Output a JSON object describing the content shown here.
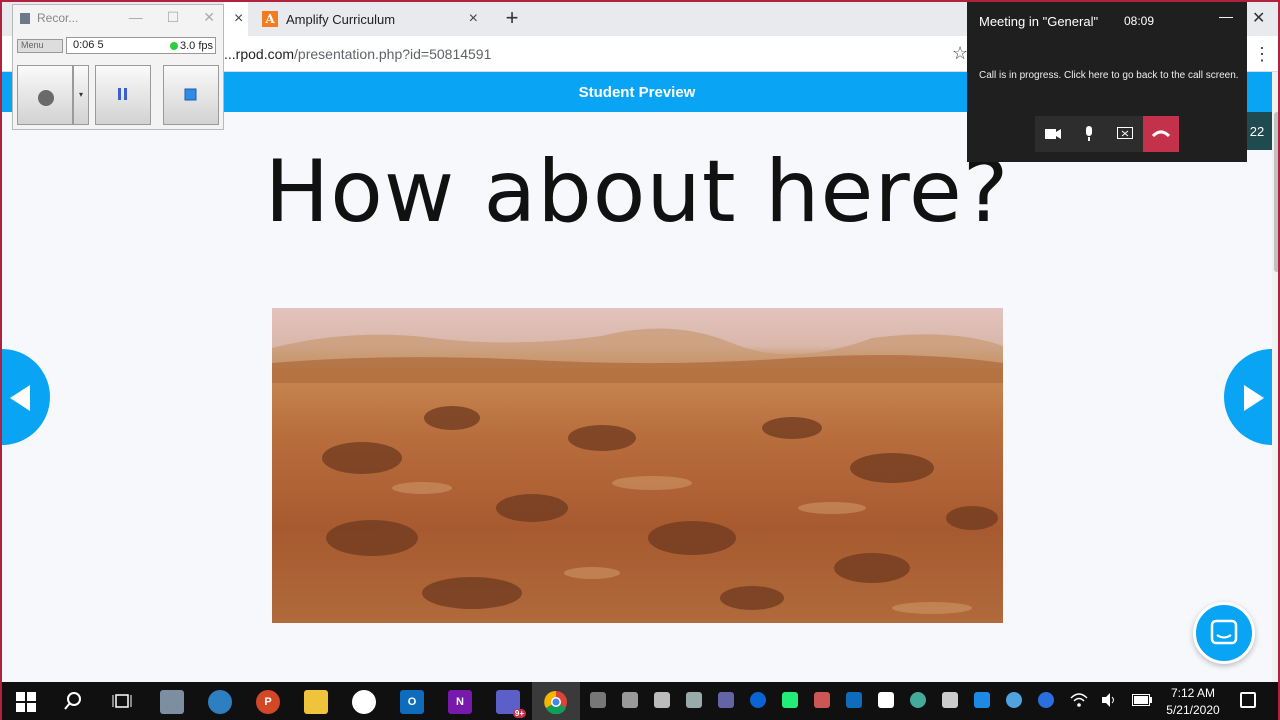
{
  "browser": {
    "tabs": [
      {
        "label": "Amplify Curriculum",
        "close": "×"
      }
    ],
    "first_tab_close": "×",
    "new_tab": "+",
    "url_prefix": "...rpod.com",
    "url_path": "/presentation.php?id=50814591",
    "star": "☆",
    "menu": "⋮"
  },
  "page": {
    "banner": "Student Preview",
    "slide_title": "How about here?",
    "counter": "22"
  },
  "recorder": {
    "title": "Recor...",
    "menu": "Menu",
    "time": "0:06 5",
    "fps": "3.0 fps",
    "min": "—",
    "max": "☐",
    "close": "✕",
    "drop": "▾"
  },
  "teams": {
    "title": "Meeting in \"General\"",
    "time": "08:09",
    "minimize": "—",
    "body": "Call is in progress. Click here to go back to the call screen.",
    "close": "✕"
  },
  "taskbar": {
    "time": "7:12 AM",
    "date": "5/21/2020",
    "teams_badge": "9+"
  },
  "colors": {
    "accent": "#0aa4f5",
    "hangup": "#c4314b"
  }
}
